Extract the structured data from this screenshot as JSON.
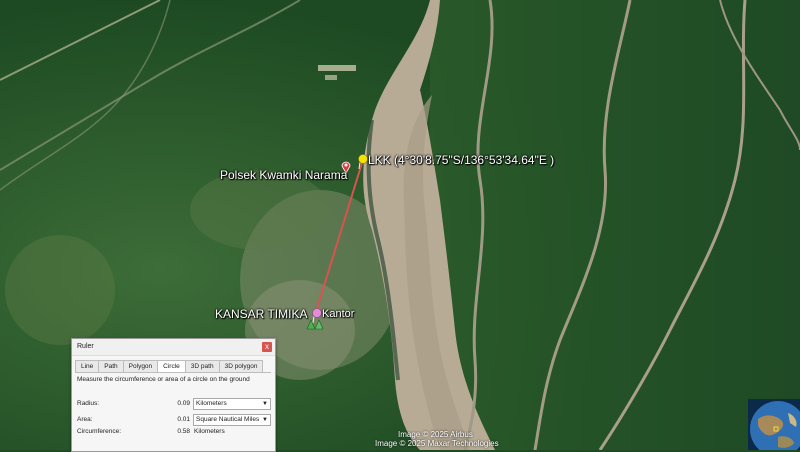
{
  "map": {
    "labels": {
      "polsek": "Polsek Kwamki Narama",
      "lkk": "LKK (4°30'8.75\"S/136°53'34.64\"E )",
      "kansar": "KANSAR TIMIKA",
      "kantor": "Kantor"
    },
    "attribution": {
      "airbus": "Image © 2025 Airbus",
      "maxar": "Image © 2025 Maxar Technologies"
    }
  },
  "ruler": {
    "title": "Ruler",
    "close_glyph": "x",
    "tabs": [
      "Line",
      "Path",
      "Polygon",
      "Circle",
      "3D path",
      "3D polygon"
    ],
    "active_tab": "Circle",
    "description": "Measure the circumference or area of a circle on the ground",
    "radius": {
      "label": "Radius:",
      "value": "0.09",
      "unit": "Kilometers"
    },
    "area": {
      "label": "Area:",
      "value": "0.01",
      "unit": "Square Nautical Miles"
    },
    "circumference": {
      "label": "Circumference:",
      "value": "0.58",
      "unit": "Kilometers"
    }
  },
  "icons": {
    "placemark": "red-pin-icon",
    "lkk": "yellow-pushpin-icon",
    "kantor": "pink-pushpin-icon",
    "group": "green-tent-icon"
  },
  "colors": {
    "measure_line": "#d9534f",
    "river": "#b9ae9a",
    "forest": "#24562a"
  }
}
